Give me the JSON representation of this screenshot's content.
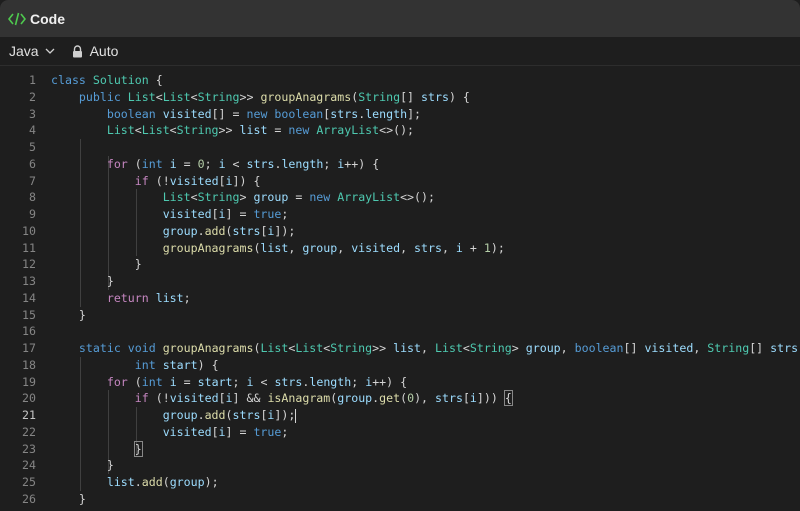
{
  "window": {
    "title": "Code"
  },
  "toolbar": {
    "language": "Java",
    "mode": "Auto"
  },
  "editor": {
    "active_line": 21,
    "lines": [
      {
        "n": "1",
        "tokens": [
          [
            "k",
            "class"
          ],
          [
            "p",
            " "
          ],
          [
            "t",
            "Solution"
          ],
          [
            "p",
            " {"
          ]
        ]
      },
      {
        "n": "2",
        "tokens": [
          [
            "p",
            "    "
          ],
          [
            "k",
            "public"
          ],
          [
            "p",
            " "
          ],
          [
            "t",
            "List"
          ],
          [
            "p",
            "<"
          ],
          [
            "t",
            "List"
          ],
          [
            "p",
            "<"
          ],
          [
            "t",
            "String"
          ],
          [
            "p",
            ">> "
          ],
          [
            "f",
            "groupAnagrams"
          ],
          [
            "p",
            "("
          ],
          [
            "t",
            "String"
          ],
          [
            "p",
            "[] "
          ],
          [
            "v",
            "strs"
          ],
          [
            "p",
            ") {"
          ]
        ]
      },
      {
        "n": "3",
        "tokens": [
          [
            "p",
            "        "
          ],
          [
            "k",
            "boolean"
          ],
          [
            "p",
            " "
          ],
          [
            "v",
            "visited"
          ],
          [
            "p",
            "[] = "
          ],
          [
            "k",
            "new"
          ],
          [
            "p",
            " "
          ],
          [
            "k",
            "boolean"
          ],
          [
            "p",
            "["
          ],
          [
            "v",
            "strs"
          ],
          [
            "p",
            "."
          ],
          [
            "v",
            "length"
          ],
          [
            "p",
            "];"
          ]
        ]
      },
      {
        "n": "4",
        "tokens": [
          [
            "p",
            "        "
          ],
          [
            "t",
            "List"
          ],
          [
            "p",
            "<"
          ],
          [
            "t",
            "List"
          ],
          [
            "p",
            "<"
          ],
          [
            "t",
            "String"
          ],
          [
            "p",
            ">> "
          ],
          [
            "v",
            "list"
          ],
          [
            "p",
            " = "
          ],
          [
            "k",
            "new"
          ],
          [
            "p",
            " "
          ],
          [
            "t",
            "ArrayList"
          ],
          [
            "p",
            "<>();"
          ]
        ]
      },
      {
        "n": "5",
        "tokens": []
      },
      {
        "n": "6",
        "tokens": [
          [
            "p",
            "        "
          ],
          [
            "ctl",
            "for"
          ],
          [
            "p",
            " ("
          ],
          [
            "k",
            "int"
          ],
          [
            "p",
            " "
          ],
          [
            "v",
            "i"
          ],
          [
            "p",
            " = "
          ],
          [
            "n",
            "0"
          ],
          [
            "p",
            "; "
          ],
          [
            "v",
            "i"
          ],
          [
            "p",
            " < "
          ],
          [
            "v",
            "strs"
          ],
          [
            "p",
            "."
          ],
          [
            "v",
            "length"
          ],
          [
            "p",
            "; "
          ],
          [
            "v",
            "i"
          ],
          [
            "p",
            "++) {"
          ]
        ]
      },
      {
        "n": "7",
        "tokens": [
          [
            "p",
            "            "
          ],
          [
            "ctl",
            "if"
          ],
          [
            "p",
            " (!"
          ],
          [
            "v",
            "visited"
          ],
          [
            "p",
            "["
          ],
          [
            "v",
            "i"
          ],
          [
            "p",
            "]) {"
          ]
        ]
      },
      {
        "n": "8",
        "tokens": [
          [
            "p",
            "                "
          ],
          [
            "t",
            "List"
          ],
          [
            "p",
            "<"
          ],
          [
            "t",
            "String"
          ],
          [
            "p",
            "> "
          ],
          [
            "v",
            "group"
          ],
          [
            "p",
            " = "
          ],
          [
            "k",
            "new"
          ],
          [
            "p",
            " "
          ],
          [
            "t",
            "ArrayList"
          ],
          [
            "p",
            "<>();"
          ]
        ]
      },
      {
        "n": "9",
        "tokens": [
          [
            "p",
            "                "
          ],
          [
            "v",
            "visited"
          ],
          [
            "p",
            "["
          ],
          [
            "v",
            "i"
          ],
          [
            "p",
            "] = "
          ],
          [
            "k",
            "true"
          ],
          [
            "p",
            ";"
          ]
        ]
      },
      {
        "n": "10",
        "tokens": [
          [
            "p",
            "                "
          ],
          [
            "v",
            "group"
          ],
          [
            "p",
            "."
          ],
          [
            "f",
            "add"
          ],
          [
            "p",
            "("
          ],
          [
            "v",
            "strs"
          ],
          [
            "p",
            "["
          ],
          [
            "v",
            "i"
          ],
          [
            "p",
            "]);"
          ]
        ]
      },
      {
        "n": "11",
        "tokens": [
          [
            "p",
            "                "
          ],
          [
            "f",
            "groupAnagrams"
          ],
          [
            "p",
            "("
          ],
          [
            "v",
            "list"
          ],
          [
            "p",
            ", "
          ],
          [
            "v",
            "group"
          ],
          [
            "p",
            ", "
          ],
          [
            "v",
            "visited"
          ],
          [
            "p",
            ", "
          ],
          [
            "v",
            "strs"
          ],
          [
            "p",
            ", "
          ],
          [
            "v",
            "i"
          ],
          [
            "p",
            " + "
          ],
          [
            "n",
            "1"
          ],
          [
            "p",
            ");"
          ]
        ]
      },
      {
        "n": "12",
        "tokens": [
          [
            "p",
            "            }"
          ]
        ]
      },
      {
        "n": "13",
        "tokens": [
          [
            "p",
            "        }"
          ]
        ]
      },
      {
        "n": "14",
        "tokens": [
          [
            "p",
            "        "
          ],
          [
            "ctl",
            "return"
          ],
          [
            "p",
            " "
          ],
          [
            "v",
            "list"
          ],
          [
            "p",
            ";"
          ]
        ]
      },
      {
        "n": "15",
        "tokens": [
          [
            "p",
            "    }"
          ]
        ]
      },
      {
        "n": "16",
        "tokens": []
      },
      {
        "n": "17",
        "tokens": [
          [
            "p",
            "    "
          ],
          [
            "k",
            "static"
          ],
          [
            "p",
            " "
          ],
          [
            "k",
            "void"
          ],
          [
            "p",
            " "
          ],
          [
            "f",
            "groupAnagrams"
          ],
          [
            "p",
            "("
          ],
          [
            "t",
            "List"
          ],
          [
            "p",
            "<"
          ],
          [
            "t",
            "List"
          ],
          [
            "p",
            "<"
          ],
          [
            "t",
            "String"
          ],
          [
            "p",
            ">> "
          ],
          [
            "v",
            "list"
          ],
          [
            "p",
            ", "
          ],
          [
            "t",
            "List"
          ],
          [
            "p",
            "<"
          ],
          [
            "t",
            "String"
          ],
          [
            "p",
            "> "
          ],
          [
            "v",
            "group"
          ],
          [
            "p",
            ", "
          ],
          [
            "k",
            "boolean"
          ],
          [
            "p",
            "[] "
          ],
          [
            "v",
            "visited"
          ],
          [
            "p",
            ", "
          ],
          [
            "t",
            "String"
          ],
          [
            "p",
            "[] "
          ],
          [
            "v",
            "strs"
          ],
          [
            "p",
            ","
          ]
        ]
      },
      {
        "n": "18",
        "tokens": [
          [
            "p",
            "            "
          ],
          [
            "k",
            "int"
          ],
          [
            "p",
            " "
          ],
          [
            "v",
            "start"
          ],
          [
            "p",
            ") {"
          ]
        ]
      },
      {
        "n": "19",
        "tokens": [
          [
            "p",
            "        "
          ],
          [
            "ctl",
            "for"
          ],
          [
            "p",
            " ("
          ],
          [
            "k",
            "int"
          ],
          [
            "p",
            " "
          ],
          [
            "v",
            "i"
          ],
          [
            "p",
            " = "
          ],
          [
            "v",
            "start"
          ],
          [
            "p",
            "; "
          ],
          [
            "v",
            "i"
          ],
          [
            "p",
            " < "
          ],
          [
            "v",
            "strs"
          ],
          [
            "p",
            "."
          ],
          [
            "v",
            "length"
          ],
          [
            "p",
            "; "
          ],
          [
            "v",
            "i"
          ],
          [
            "p",
            "++) {"
          ]
        ]
      },
      {
        "n": "20",
        "tokens": [
          [
            "p",
            "            "
          ],
          [
            "ctl",
            "if"
          ],
          [
            "p",
            " (!"
          ],
          [
            "v",
            "visited"
          ],
          [
            "p",
            "["
          ],
          [
            "v",
            "i"
          ],
          [
            "p",
            "] && "
          ],
          [
            "f",
            "isAnagram"
          ],
          [
            "p",
            "("
          ],
          [
            "v",
            "group"
          ],
          [
            "p",
            "."
          ],
          [
            "f",
            "get"
          ],
          [
            "p",
            "("
          ],
          [
            "n",
            "0"
          ],
          [
            "p",
            "), "
          ],
          [
            "v",
            "strs"
          ],
          [
            "p",
            "["
          ],
          [
            "v",
            "i"
          ],
          [
            "p",
            "])) "
          ],
          [
            "bm",
            "{"
          ]
        ]
      },
      {
        "n": "21",
        "tokens": [
          [
            "p",
            "                "
          ],
          [
            "v",
            "group"
          ],
          [
            "p",
            "."
          ],
          [
            "f",
            "add"
          ],
          [
            "p",
            "("
          ],
          [
            "v",
            "strs"
          ],
          [
            "p",
            "["
          ],
          [
            "v",
            "i"
          ],
          [
            "p",
            "]);"
          ],
          [
            "cur",
            ""
          ]
        ]
      },
      {
        "n": "22",
        "tokens": [
          [
            "p",
            "                "
          ],
          [
            "v",
            "visited"
          ],
          [
            "p",
            "["
          ],
          [
            "v",
            "i"
          ],
          [
            "p",
            "] = "
          ],
          [
            "k",
            "true"
          ],
          [
            "p",
            ";"
          ]
        ]
      },
      {
        "n": "23",
        "tokens": [
          [
            "p",
            "            "
          ],
          [
            "bm",
            "}"
          ]
        ]
      },
      {
        "n": "24",
        "tokens": [
          [
            "p",
            "        }"
          ]
        ]
      },
      {
        "n": "25",
        "tokens": [
          [
            "p",
            "        "
          ],
          [
            "v",
            "list"
          ],
          [
            "p",
            "."
          ],
          [
            "f",
            "add"
          ],
          [
            "p",
            "("
          ],
          [
            "v",
            "group"
          ],
          [
            "p",
            ");"
          ]
        ]
      },
      {
        "n": "26",
        "tokens": [
          [
            "p",
            "    }"
          ]
        ]
      }
    ]
  }
}
